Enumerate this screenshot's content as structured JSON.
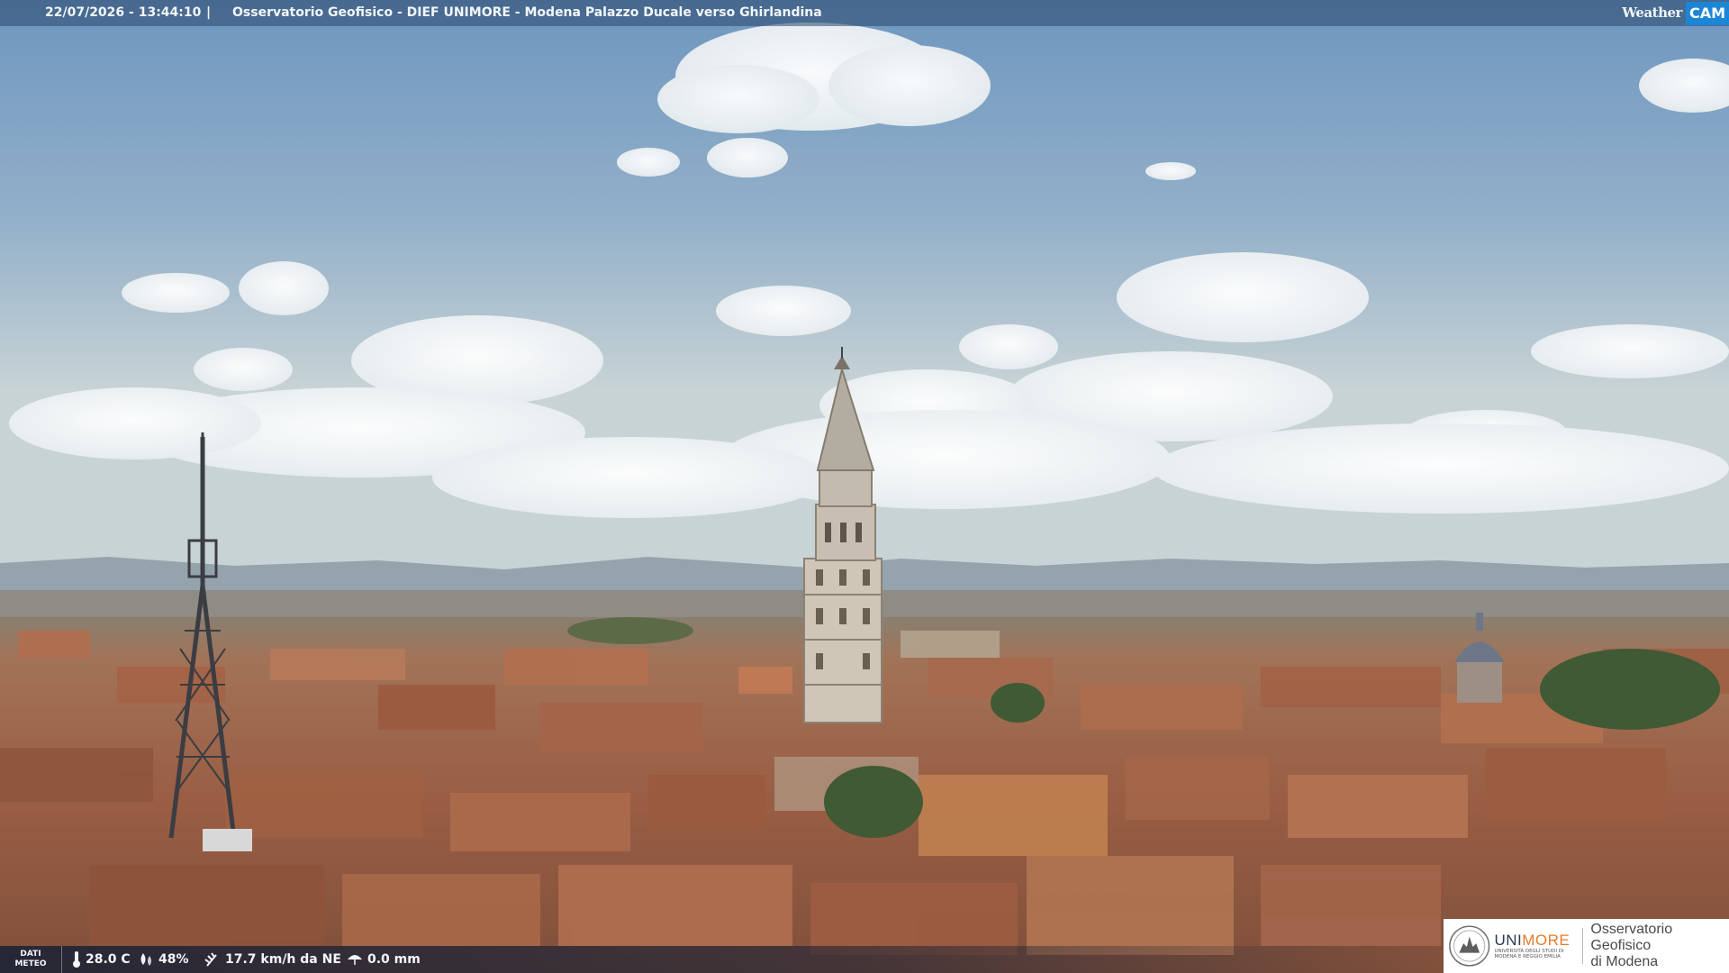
{
  "header": {
    "timestamp": "22/07/2026 - 13:44:10",
    "separator": "|",
    "caption": "Osservatorio Geofisico - DIEF UNIMORE - Modena Palazzo Ducale verso Ghirlandina",
    "logo_left": "Weather",
    "logo_right": "CAM"
  },
  "weather": {
    "label_line1": "DATI",
    "label_line2": "METEO",
    "temperature": "28.0 C",
    "humidity": "48%",
    "wind": "17.7 km/h da NE",
    "rain": "0.0 mm"
  },
  "badge": {
    "university_part1": "UNI",
    "university_part2": "MORE",
    "university_sub": "UNIVERSITÀ DEGLI STUDI DI MODENA E REGGIO EMILIA",
    "observatory_line1": "Osservatorio Geofisico",
    "observatory_line2": "di Modena"
  },
  "colors": {
    "sky_top": "#6e96bf",
    "sky_bottom": "#c7d3d6",
    "roof": "#a8654a",
    "tower": "#cfc6b8",
    "unimore_orange": "#e47b2a"
  }
}
